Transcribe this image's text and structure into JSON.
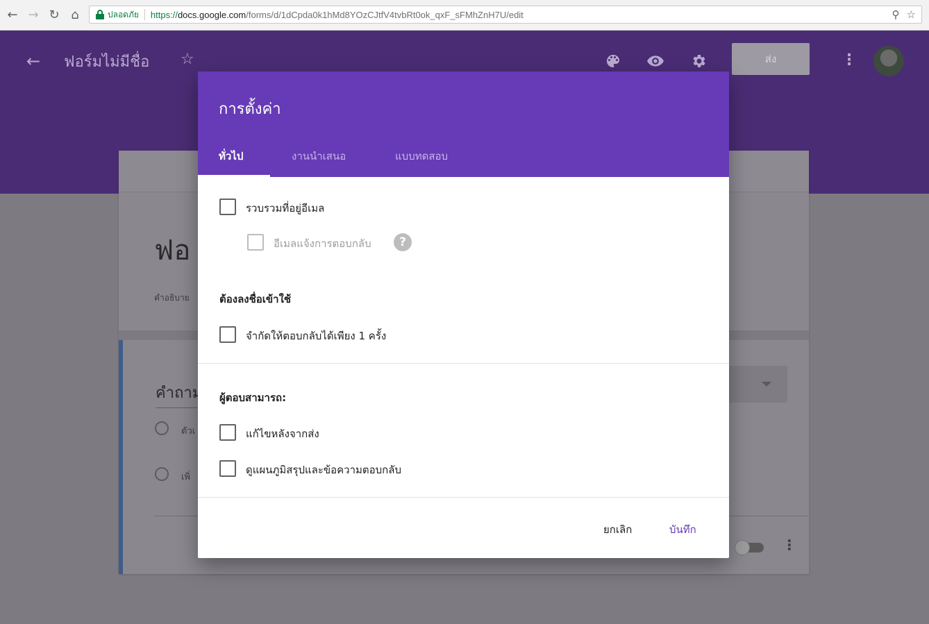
{
  "browser": {
    "secure_label": "ปลอดภัย",
    "url_scheme": "https://",
    "url_host": "docs.google.com",
    "url_path": "/forms/d/1dCpda0k1hMd8YOzCJtfV4tvbRt0ok_qxF_sFMhZnH7U/edit"
  },
  "header": {
    "title": "ฟอร์มไม่มีชื่อ",
    "send_label": "ส่ง"
  },
  "background_form": {
    "title_partial": "ฟอ",
    "description_partial": "คำอธิบาย",
    "question_partial": "คำถาม",
    "option1_partial": "ตัวเ",
    "option2_partial": "เพิ่"
  },
  "dialog": {
    "title": "การตั้งค่า",
    "tabs": [
      {
        "label": "ทั่วไป",
        "active": true
      },
      {
        "label": "งานนำเสนอ",
        "active": false
      },
      {
        "label": "แบบทดสอบ",
        "active": false
      }
    ],
    "collect_email": "รวบรวมที่อยู่อีเมล",
    "response_receipts": "อีเมลแจ้งการตอบกลับ",
    "help_glyph": "?",
    "requires_signin_heading": "ต้องลงชื่อเข้าใช้",
    "limit_one_response": "จำกัดให้ตอบกลับได้เพียง 1 ครั้ง",
    "respondents_can_heading": "ผู้ตอบสามารถ:",
    "edit_after_submit": "แก้ไขหลังจากส่ง",
    "see_summary": "ดูแผนภูมิสรุปและข้อความตอบกลับ",
    "cancel_label": "ยกเลิก",
    "save_label": "บันทึก"
  },
  "icons": {
    "back": "arrow-left-icon",
    "forward": "arrow-right-icon",
    "reload": "reload-icon",
    "home": "home-icon",
    "zoom": "zoom-icon",
    "bookmark": "star-icon",
    "palette": "palette-icon",
    "preview": "eye-icon",
    "settings": "gear-icon"
  },
  "colors": {
    "header_bg": "#4a2c74",
    "dialog_accent": "#673ab7",
    "secure_green": "#0b8043"
  }
}
